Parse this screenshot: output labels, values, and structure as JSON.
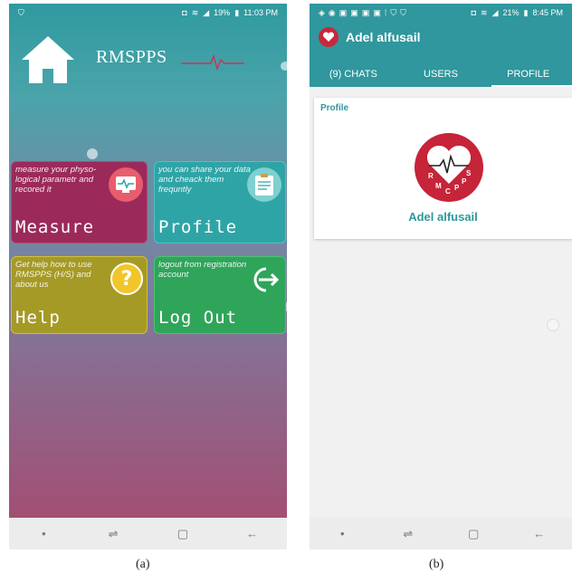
{
  "phone_a": {
    "status_time": "11:03 PM",
    "status_battery": "19%",
    "app_title": "RMSPPS",
    "tiles": [
      {
        "label": "Measure",
        "desc": "measure your physo-logical parametr and recored it",
        "icon": "heart-monitor-icon"
      },
      {
        "label": "Profile",
        "desc": "you can share your data and cheack them frequntly",
        "icon": "clipboard-icon"
      },
      {
        "label": "Help",
        "desc": "Get help how to use RMSPPS (H/S) and about us",
        "icon": "question-icon"
      },
      {
        "label": "Log Out",
        "desc": "logout from registration account",
        "icon": "logout-arrow-icon"
      }
    ]
  },
  "phone_b": {
    "status_time": "8:45 PM",
    "status_battery": "21%",
    "chat_title": "Adel alfusail",
    "tabs": [
      {
        "label": "(9) CHATS"
      },
      {
        "label": "USERS"
      },
      {
        "label": "PROFILE"
      }
    ],
    "card_heading": "Profile",
    "logo_letters": [
      "R",
      "M",
      "C",
      "P",
      "P",
      "S"
    ],
    "profile_name": "Adel alfusail"
  },
  "captions": {
    "a": "(a)",
    "b": "(b)"
  },
  "colors": {
    "teal": "#2f979d",
    "logo_red": "#c62438",
    "measure": "#9b2a5a",
    "profile": "#2fa4a6",
    "help": "#a59a26",
    "logout": "#2fa55a"
  }
}
